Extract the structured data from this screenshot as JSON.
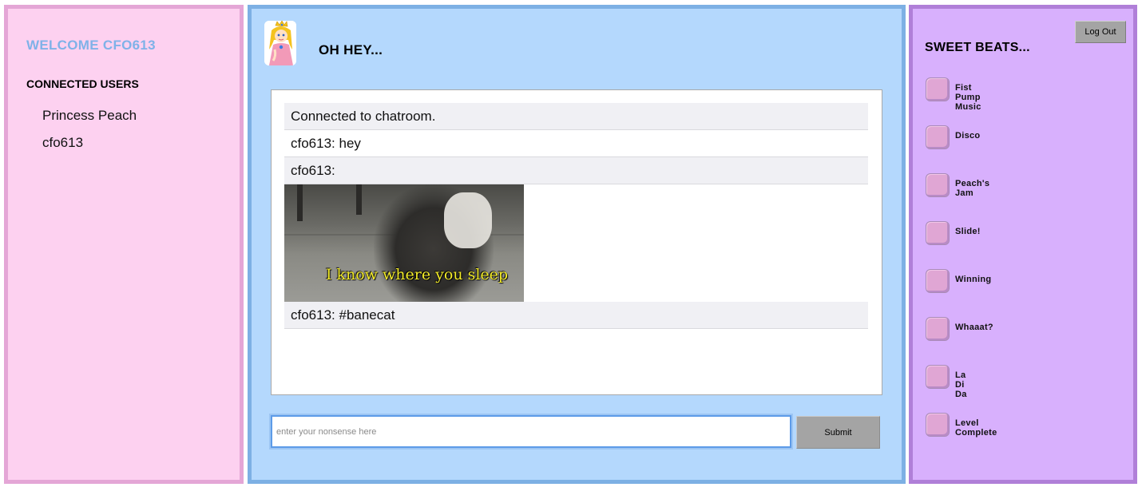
{
  "sidebar": {
    "welcome": "WELCOME CFO613",
    "users_heading": "CONNECTED USERS",
    "users": [
      "Princess Peach",
      "cfo613"
    ]
  },
  "chat": {
    "title": "OH HEY...",
    "avatar_icon": "princess-peach-avatar",
    "messages": [
      {
        "text": "Connected to chatroom."
      },
      {
        "text": "cfo613: hey"
      },
      {
        "text": "cfo613:"
      },
      {
        "gif_caption": "I know where you sleep"
      },
      {
        "text": "cfo613: #banecat"
      }
    ],
    "input": {
      "value": "",
      "placeholder": "enter your nonsense here"
    },
    "submit_label": "Submit"
  },
  "beats": {
    "logout_label": "Log Out",
    "title": "SWEET BEATS...",
    "items": [
      "Fist Pump Music",
      "Disco",
      "Peach's Jam",
      "Slide!",
      "Winning",
      "Whaaat?",
      "La Di Da",
      "Level Complete"
    ]
  },
  "colors": {
    "left_bg": "#fdd1f0",
    "center_bg": "#b4d8fd",
    "right_bg": "#d8b0fd",
    "accent": "#7fb2e8",
    "beat_button": "#e0a6d4"
  }
}
